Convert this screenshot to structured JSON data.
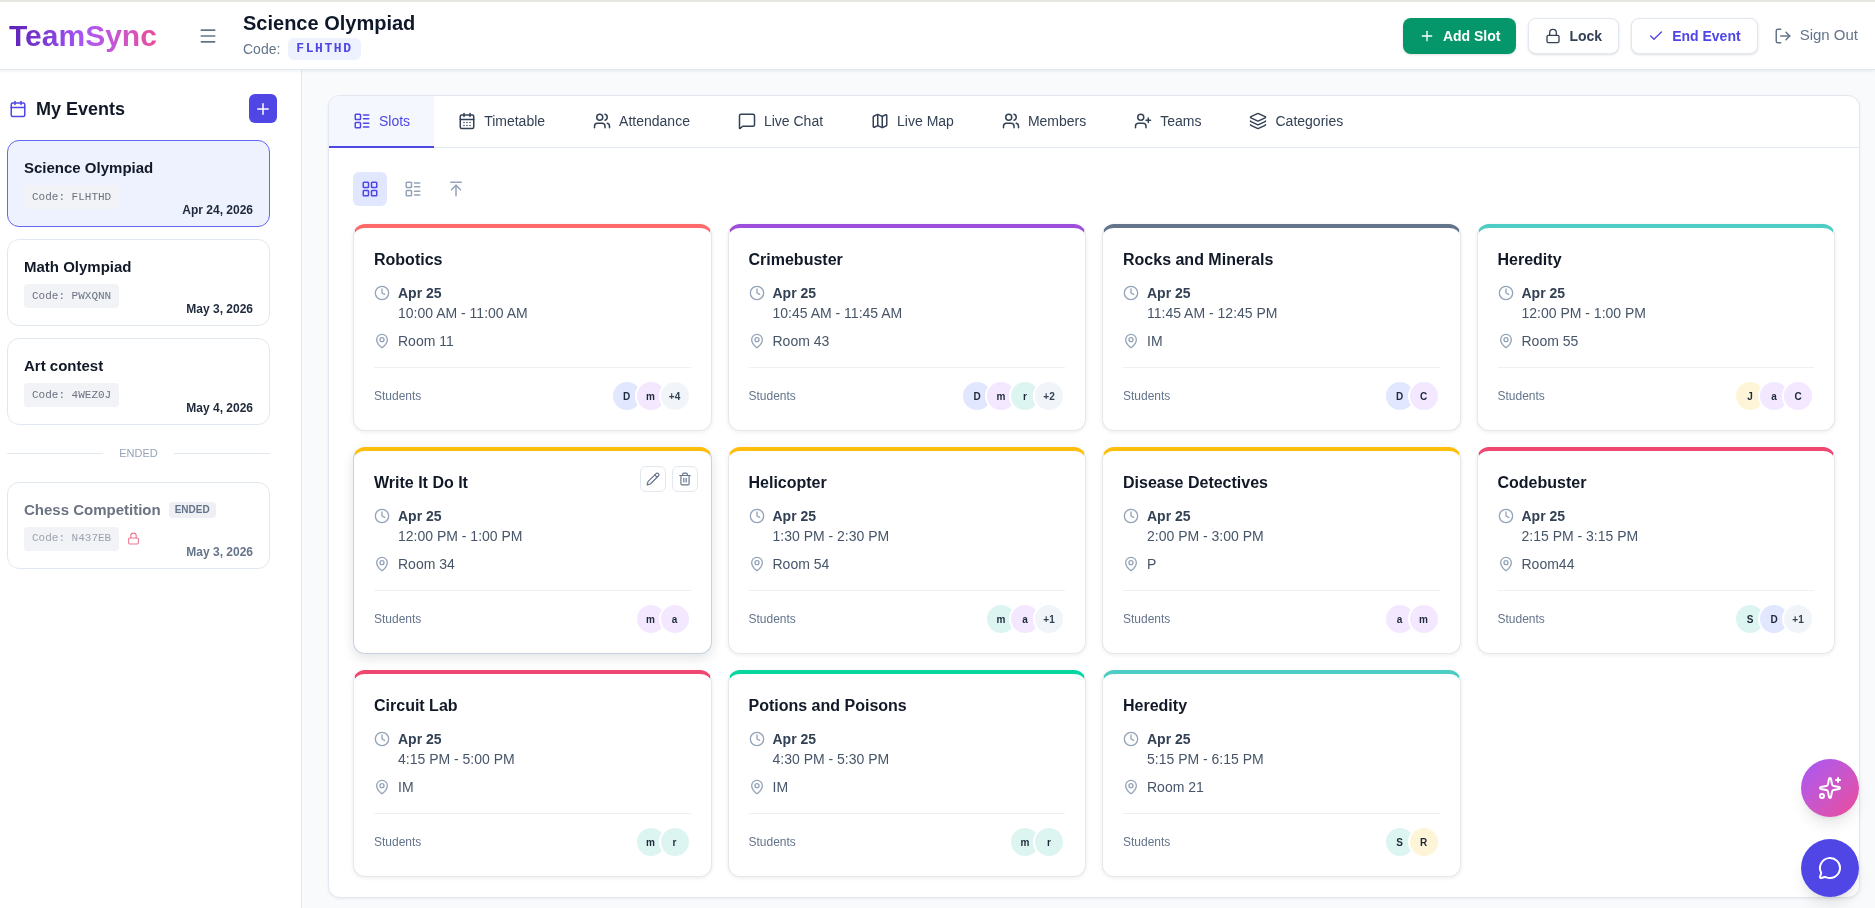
{
  "header": {
    "logo": "TeamSync",
    "title": "Science Olympiad",
    "code_label": "Code:",
    "code": "FLHTHD",
    "buttons": [
      {
        "kind": "add",
        "label": "Add Slot"
      },
      {
        "kind": "lock",
        "label": "Lock"
      },
      {
        "kind": "end",
        "label": "End Event"
      },
      {
        "kind": "signout",
        "label": "Sign Out"
      }
    ]
  },
  "sidebar": {
    "title": "My Events",
    "events": [
      {
        "name": "Science Olympiad",
        "code": "Code: FLHTHD",
        "date": "Apr 24, 2026",
        "selected": true,
        "locked": false
      },
      {
        "name": "Math Olympiad",
        "code": "Code: PWXQNN",
        "date": "May 3, 2026",
        "selected": false,
        "locked": false
      },
      {
        "name": "Art contest",
        "code": "Code: 4WEZ0J",
        "date": "May 4, 2026",
        "selected": false,
        "locked": false
      }
    ],
    "ended_label": "ENDED",
    "ended_events": [
      {
        "name": "Chess Competition",
        "badge": "ENDED",
        "code": "Code: N437EB",
        "date": "May 3, 2026",
        "selected": false,
        "locked": true
      }
    ]
  },
  "tabs": [
    {
      "label": "Slots",
      "selected": true
    },
    {
      "label": "Timetable",
      "selected": false
    },
    {
      "label": "Attendance",
      "selected": false
    },
    {
      "label": "Live Chat",
      "selected": false
    },
    {
      "label": "Live Map",
      "selected": false
    },
    {
      "label": "Members",
      "selected": false
    },
    {
      "label": "Teams",
      "selected": false
    },
    {
      "label": "Categories",
      "selected": false
    }
  ],
  "view_modes": [
    {
      "kind": "grid",
      "selected": true
    },
    {
      "kind": "list",
      "selected": false
    }
  ],
  "slots": [
    {
      "title": "Robotics",
      "color": "#ff6b6b",
      "hovered": false,
      "date": "Apr 25",
      "time": "10:00 AM - 11:00 AM",
      "location": "Room 11",
      "members_label": "Students",
      "avatars": [
        {
          "initial": "D",
          "color": "#e0e7ff"
        },
        {
          "initial": "m",
          "color": "#f3e8ff"
        }
      ],
      "more": "+4"
    },
    {
      "title": "Crimebuster",
      "color": "#9d4edd",
      "hovered": false,
      "date": "Apr 25",
      "time": "10:45 AM - 11:45 AM",
      "location": "Room 43",
      "members_label": "Students",
      "avatars": [
        {
          "initial": "D",
          "color": "#e0e7ff"
        },
        {
          "initial": "m",
          "color": "#f3e8ff"
        },
        {
          "initial": "r",
          "color": "#ddf5f1"
        }
      ],
      "more": "+2"
    },
    {
      "title": "Rocks and Minerals",
      "color": "#64748b",
      "hovered": false,
      "date": "Apr 25",
      "time": "11:45 AM - 12:45 PM",
      "location": "IM",
      "members_label": "Students",
      "avatars": [
        {
          "initial": "D",
          "color": "#e0e7ff"
        },
        {
          "initial": "C",
          "color": "#f3e8ff"
        }
      ]
    },
    {
      "title": "Heredity",
      "color": "#4ecdc4",
      "hovered": false,
      "date": "Apr 25",
      "time": "12:00 PM - 1:00 PM",
      "location": "Room 55",
      "members_label": "Students",
      "avatars": [
        {
          "initial": "J",
          "color": "#fef5d8"
        },
        {
          "initial": "a",
          "color": "#f3e8ff"
        },
        {
          "initial": "C",
          "color": "#f3e8ff"
        }
      ]
    },
    {
      "title": "Write It Do It",
      "color": "#ffbe0b",
      "hovered": true,
      "date": "Apr 25",
      "time": "12:00 PM - 1:00 PM",
      "location": "Room 34",
      "members_label": "Students",
      "avatars": [
        {
          "initial": "m",
          "color": "#f3e8ff"
        },
        {
          "initial": "a",
          "color": "#f3e8ff"
        }
      ]
    },
    {
      "title": "Helicopter",
      "color": "#ffbe0b",
      "hovered": false,
      "date": "Apr 25",
      "time": "1:30 PM - 2:30 PM",
      "location": "Room 54",
      "members_label": "Students",
      "avatars": [
        {
          "initial": "m",
          "color": "#ddf5f1"
        },
        {
          "initial": "a",
          "color": "#f3e8ff"
        }
      ],
      "more": "+1"
    },
    {
      "title": "Disease Detectives",
      "color": "#ffbe0b",
      "hovered": false,
      "date": "Apr 25",
      "time": "2:00 PM - 3:00 PM",
      "location": "P",
      "members_label": "Students",
      "avatars": [
        {
          "initial": "a",
          "color": "#f3e8ff"
        },
        {
          "initial": "m",
          "color": "#f3e8ff"
        }
      ]
    },
    {
      "title": "Codebuster",
      "color": "#ef476f",
      "hovered": false,
      "date": "Apr 25",
      "time": "2:15 PM - 3:15 PM",
      "location": "Room44",
      "members_label": "Students",
      "avatars": [
        {
          "initial": "S",
          "color": "#ddf5f1"
        },
        {
          "initial": "D",
          "color": "#e0e7ff"
        }
      ],
      "more": "+1"
    },
    {
      "title": "Circuit Lab",
      "color": "#ef476f",
      "hovered": false,
      "date": "Apr 25",
      "time": "4:15 PM - 5:00 PM",
      "location": "IM",
      "members_label": "Students",
      "avatars": [
        {
          "initial": "m",
          "color": "#ddf5f1"
        },
        {
          "initial": "r",
          "color": "#ddf5f1"
        }
      ]
    },
    {
      "title": "Potions and Poisons",
      "color": "#06d6a0",
      "hovered": false,
      "date": "Apr 25",
      "time": "4:30 PM - 5:30 PM",
      "location": "IM",
      "members_label": "Students",
      "avatars": [
        {
          "initial": "m",
          "color": "#ddf5f1"
        },
        {
          "initial": "r",
          "color": "#ddf5f1"
        }
      ]
    },
    {
      "title": "Heredity",
      "color": "#4ecdc4",
      "hovered": false,
      "date": "Apr 25",
      "time": "5:15 PM - 6:15 PM",
      "location": "Room 21",
      "members_label": "Students",
      "avatars": [
        {
          "initial": "S",
          "color": "#ddf5f1"
        },
        {
          "initial": "R",
          "color": "#fef5d8"
        }
      ]
    }
  ]
}
